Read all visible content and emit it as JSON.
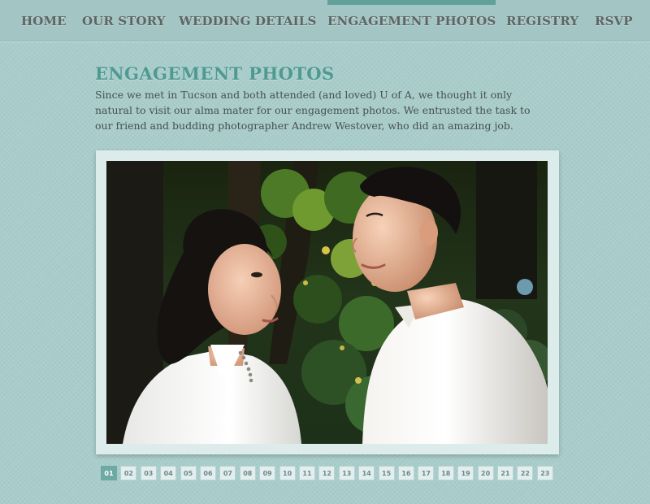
{
  "nav": {
    "items": [
      {
        "label": "HOME"
      },
      {
        "label": "OUR STORY"
      },
      {
        "label": "WEDDING DETAILS"
      },
      {
        "label": "ENGAGEMENT PHOTOS",
        "active": true
      },
      {
        "label": "REGISTRY"
      },
      {
        "label": "RSVP"
      }
    ]
  },
  "page": {
    "title": "ENGAGEMENT PHOTOS",
    "intro": "Since we met in Tucson and both attended (and loved) U of A, we thought it only natural to visit our alma mater for our engagement photos. We entrusted the task to our friend and budding photographer Andrew Westover, who did an amazing job."
  },
  "gallery": {
    "current": "01",
    "pages": [
      "01",
      "02",
      "03",
      "04",
      "05",
      "06",
      "07",
      "08",
      "09",
      "10",
      "11",
      "12",
      "13",
      "14",
      "15",
      "16",
      "17",
      "18",
      "19",
      "20",
      "21",
      "22",
      "23"
    ]
  },
  "colors": {
    "background": "#a9cdcb",
    "accent": "#4f9993",
    "nav_text": "#5e6565",
    "active_indicator": "#61a19c"
  }
}
